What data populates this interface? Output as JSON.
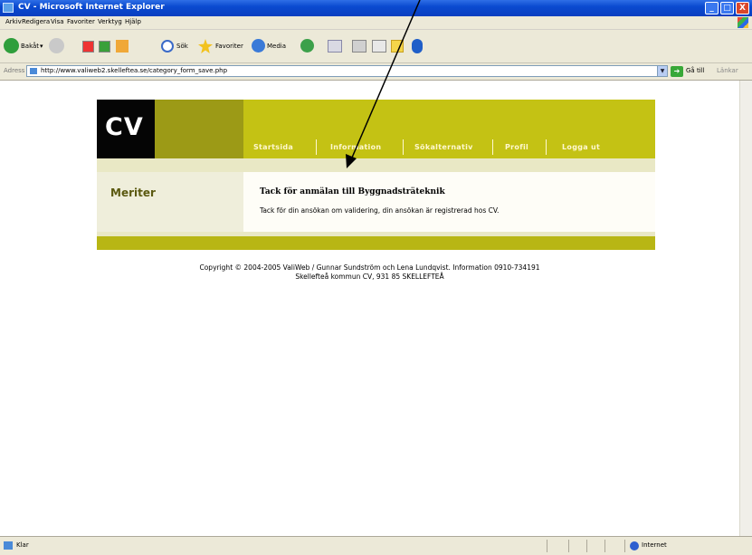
{
  "window": {
    "title": "CV - Microsoft Internet Explorer",
    "buttons": {
      "minimize": "_",
      "maximize": "□",
      "close": "X"
    }
  },
  "menu": [
    "Arkiv",
    "Redigera",
    "Visa",
    "Favoriter",
    "Verktyg",
    "Hjälp"
  ],
  "toolbar": {
    "back_label": "Bakåt",
    "search_label": "Sök",
    "favorites_label": "Favoriter",
    "media_label": "Media"
  },
  "address_bar": {
    "label": "Adress",
    "url": "http://www.valiweb2.skelleftea.se/category_form_save.php",
    "go_label": "Gå till",
    "links_label": "Länkar"
  },
  "site": {
    "logo": "CV",
    "nav": [
      "Startsida",
      "Information",
      "Sökalternativ",
      "Profil",
      "Logga ut"
    ],
    "side_title": "Meriter",
    "message_heading": "Tack för anmälan till Byggnadsträteknik",
    "message_body": "Tack för din ansökan om validering, din ansökan är registrerad hos CV.",
    "copyright_line1": "Copyright © 2004-2005 ValiWeb / Gunnar Sundström och Lena Lundqvist. Information 0910-734191",
    "copyright_line2": "Skellefteå kommun CV,  931 85 SKELLEFTEÅ",
    "colors": {
      "header_dark": "#9c9a16",
      "header_light": "#c4c214",
      "footer_band": "#b8b614",
      "accent_text": "#5b5910"
    }
  },
  "status_bar": {
    "status": "Klar",
    "zone": "Internet"
  }
}
